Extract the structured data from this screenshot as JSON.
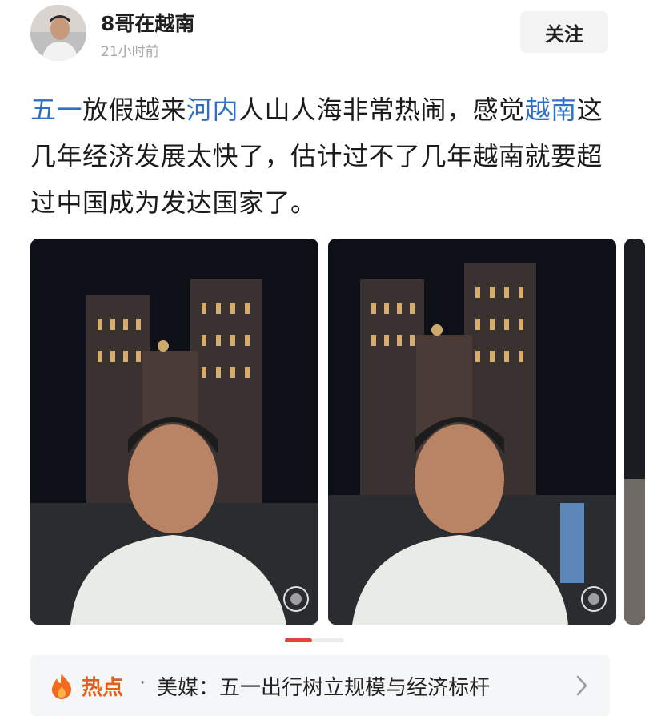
{
  "author": {
    "name": "8哥在越南",
    "timestamp": "21小时前"
  },
  "follow_label": "关注",
  "post": {
    "segments": [
      {
        "text": "五一",
        "link": true
      },
      {
        "text": "放假越来",
        "link": false
      },
      {
        "text": "河内",
        "link": true
      },
      {
        "text": "人山人海非常热闹，感觉",
        "link": false
      },
      {
        "text": "越南",
        "link": true
      },
      {
        "text": "这几年经济发展太快了，估计过不了几年越南就要超过中国成为发达国家了。",
        "link": false
      }
    ]
  },
  "photos": [
    {
      "name": "photo-1"
    },
    {
      "name": "photo-2"
    },
    {
      "name": "photo-3-partial"
    }
  ],
  "hot": {
    "label": "热点",
    "dot": "·",
    "headline": "美媒：五一出行树立规模与经济标杆"
  },
  "colors": {
    "link": "#2f6fc4",
    "hot": "#e35f1b",
    "pager_active": "#e0463d"
  },
  "icons": {
    "hot": "fire-icon",
    "more": "chevron-right-icon"
  }
}
